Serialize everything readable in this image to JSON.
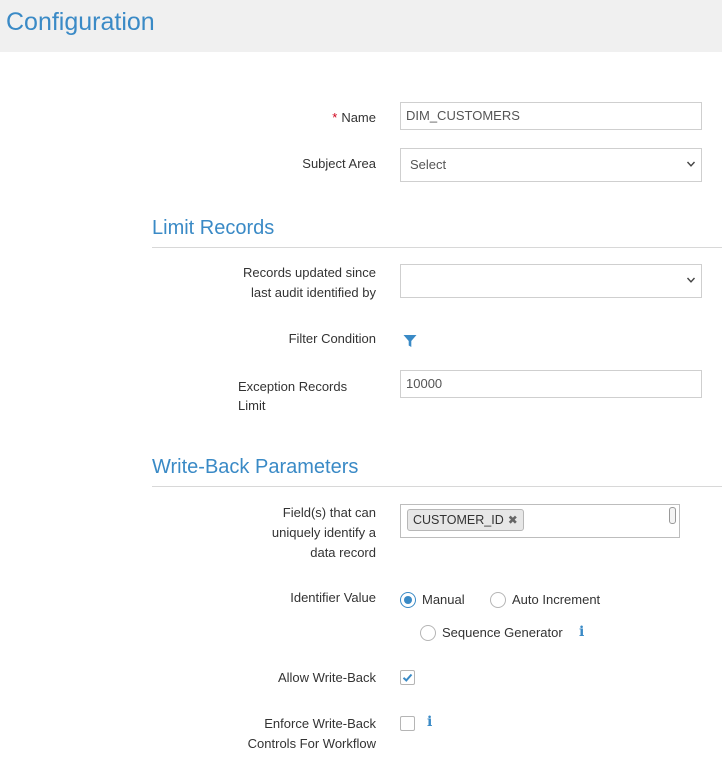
{
  "header": {
    "title": "Configuration"
  },
  "form": {
    "name": {
      "required_mark": "*",
      "label": "Name",
      "value": "DIM_CUSTOMERS"
    },
    "subject_area": {
      "label": "Subject Area",
      "value": "Select"
    }
  },
  "limit_records": {
    "title": "Limit Records",
    "records_updated": {
      "label_line1": "Records updated since",
      "label_line2": "last audit identified by",
      "value": ""
    },
    "filter_condition": {
      "label": "Filter Condition",
      "icon": "filter-icon"
    },
    "exception_limit": {
      "label_line1": "Exception Records",
      "label_line2": "Limit",
      "placeholder": "10000"
    }
  },
  "write_back": {
    "title": "Write-Back Parameters",
    "unique_fields": {
      "label_line1": "Field(s) that can",
      "label_line2": "uniquely identify a",
      "label_line3": "data record",
      "tags": [
        "CUSTOMER_ID"
      ],
      "remove_glyph": "✖"
    },
    "identifier_value": {
      "label": "Identifier Value",
      "options": [
        "Manual",
        "Auto Increment",
        "Sequence Generator"
      ],
      "selected": "Manual"
    },
    "allow_write_back": {
      "label": "Allow Write-Back",
      "checked": true
    },
    "enforce_controls": {
      "label_line1": "Enforce Write-Back",
      "label_line2": "Controls For Workflow",
      "checked": false
    }
  },
  "colors": {
    "accent": "#3a8ac6",
    "required": "#d0021b",
    "header_bg": "#f0f0f0"
  }
}
